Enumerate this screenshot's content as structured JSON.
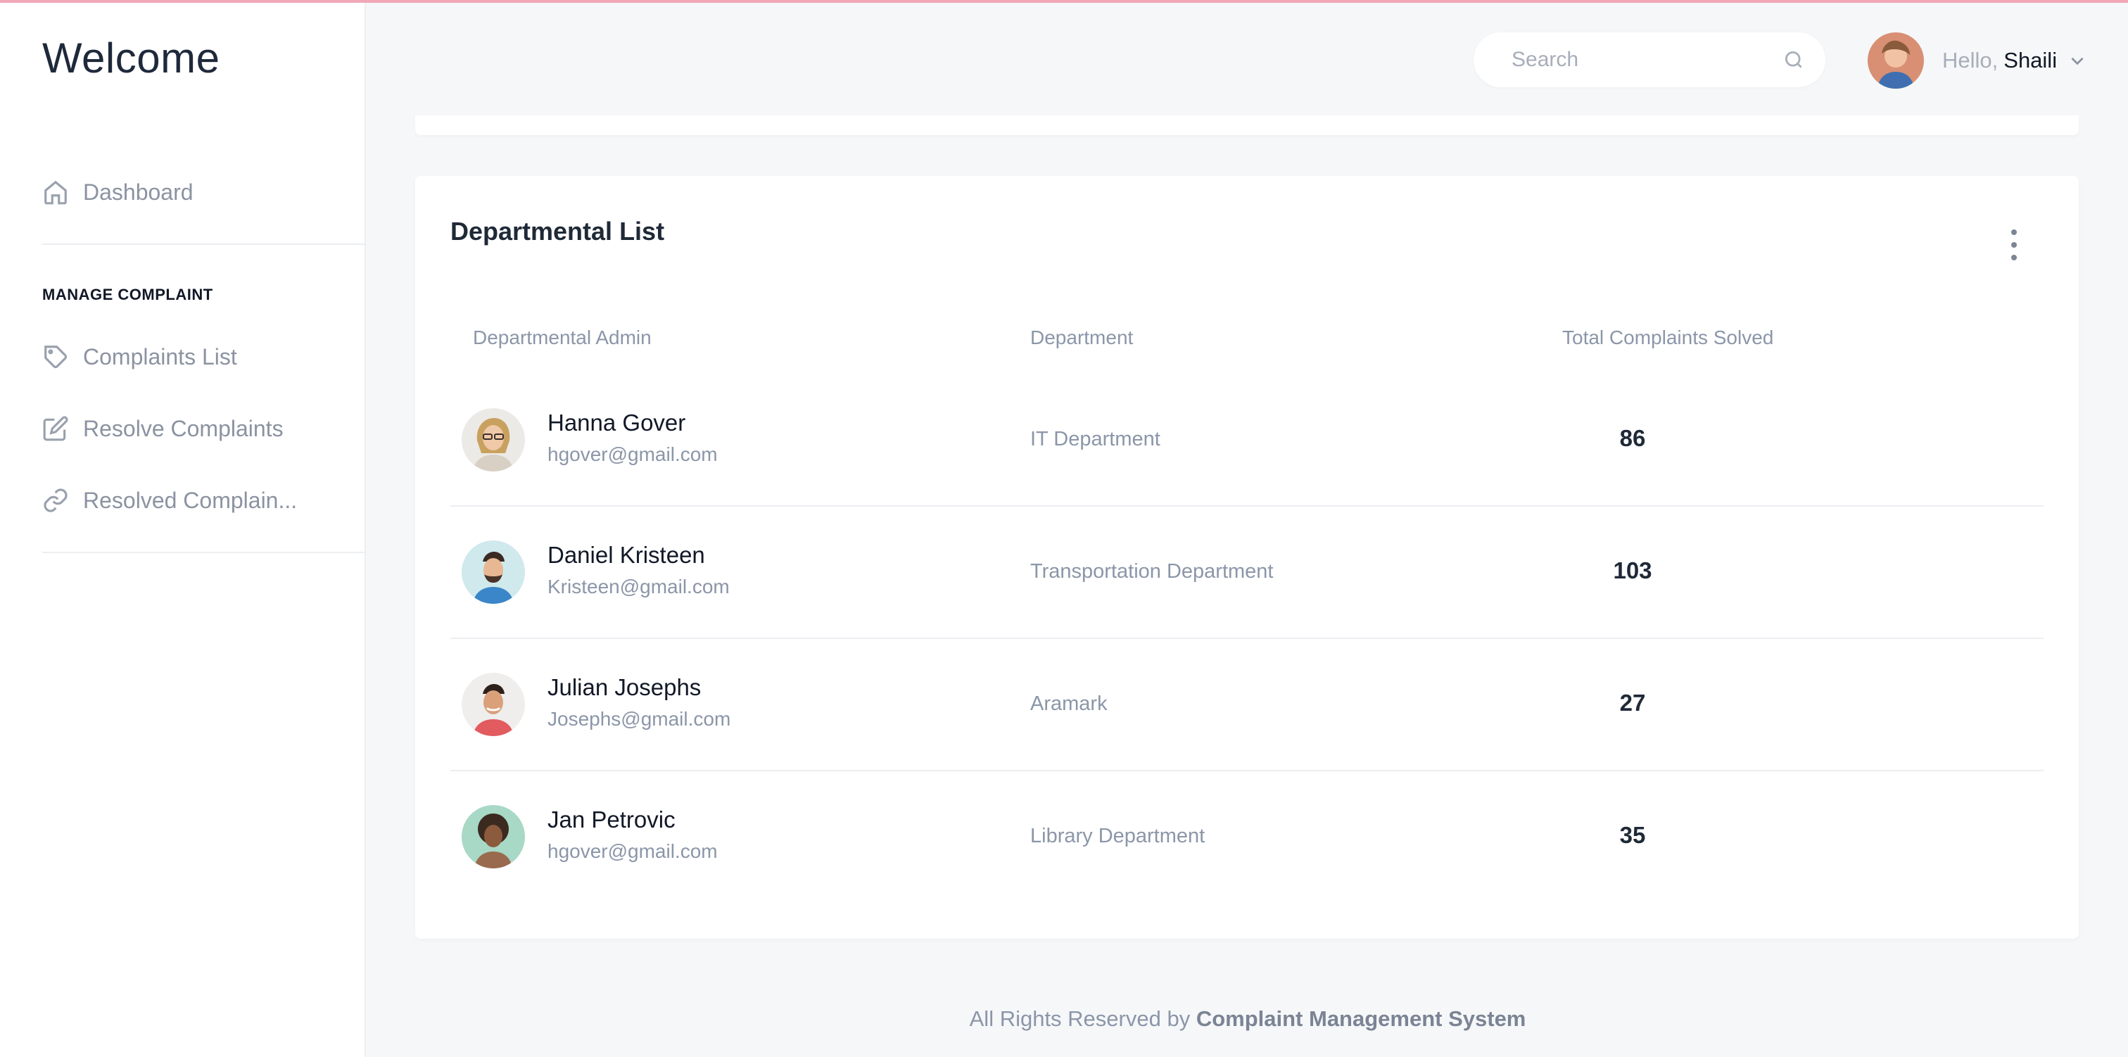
{
  "sidebar": {
    "brand": "Welcome",
    "nav": {
      "dashboard": "Dashboard",
      "section_label": "MANAGE COMPLAINT",
      "complaints_list": "Complaints List",
      "resolve_complaints": "Resolve Complaints",
      "resolved_complaints": "Resolved Complain..."
    }
  },
  "header": {
    "search": {
      "placeholder": "Search"
    },
    "user": {
      "greeting": "Hello,",
      "name": "Shaili"
    }
  },
  "main": {
    "card_title": "Departmental List",
    "columns": {
      "admin": "Departmental Admin",
      "department": "Department",
      "total": "Total Complaints Solved"
    },
    "rows": [
      {
        "name": "Hanna Gover",
        "email": "hgover@gmail.com",
        "department": "IT Department",
        "total": "86"
      },
      {
        "name": "Daniel Kristeen",
        "email": "Kristeen@gmail.com",
        "department": "Transportation Department",
        "total": "103"
      },
      {
        "name": "Julian Josephs",
        "email": "Josephs@gmail.com",
        "department": "Aramark",
        "total": "27"
      },
      {
        "name": "Jan Petrovic",
        "email": "hgover@gmail.com",
        "department": "Library Department",
        "total": "35"
      }
    ]
  },
  "footer": {
    "prefix": "All Rights Reserved by",
    "brand": "Complaint Management System"
  }
}
